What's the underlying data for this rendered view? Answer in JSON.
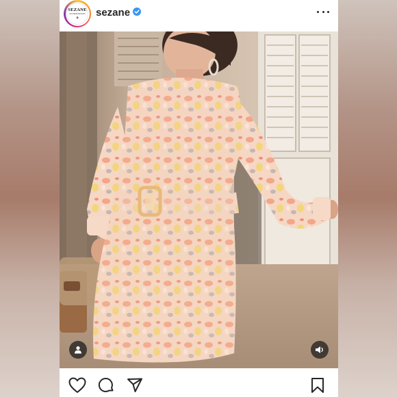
{
  "post": {
    "account": {
      "username": "sezane",
      "verified": true,
      "avatar_logo": "SEZANE",
      "avatar_logo_sub": "LES PROPOSITIONS"
    },
    "header": {
      "more_icon": "more-horizontal-icon"
    },
    "photo": {
      "tag_icon": "user-tag-icon",
      "sound_icon": "speaker-icon"
    },
    "actions": {
      "like_icon": "heart-icon",
      "comment_icon": "comment-bubble-icon",
      "share_icon": "paper-plane-icon",
      "save_icon": "bookmark-icon"
    },
    "colors": {
      "ring_gradient": [
        "#f9c43a",
        "#f58529",
        "#dd2a7b",
        "#8134af"
      ],
      "verified_blue": "#3897f0",
      "icon_dark": "#262626"
    }
  }
}
